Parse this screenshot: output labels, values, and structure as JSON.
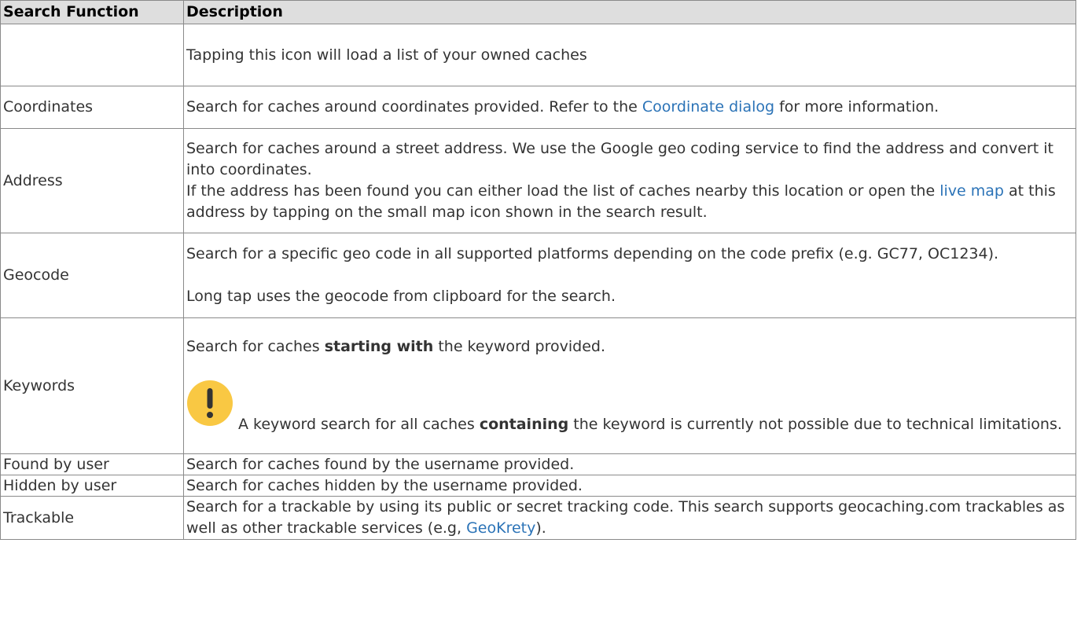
{
  "table": {
    "headers": {
      "function": "Search Function",
      "description": "Description"
    },
    "rows": [
      {
        "function": "",
        "description": "Tapping this icon will load a list of your owned caches"
      },
      {
        "function": "Coordinates",
        "desc_before": "Search for caches around coordinates provided. Refer to the ",
        "desc_link": "Coordinate dialog",
        "desc_after": " for more information."
      },
      {
        "function": "Address",
        "desc_p1": "Search for caches around a street address. We use the Google geo coding service to find the address and convert it into coordinates.",
        "desc_p2_before": "If the address has been found you can either load the list of caches nearby this location or open the ",
        "desc_p2_link": "live map",
        "desc_p2_after": " at this address by tapping on the small map icon shown in the search result."
      },
      {
        "function": "Geocode",
        "desc_p1": "Search for a specific geo code in all supported platforms depending on the code prefix (e.g. GC77, OC1234).",
        "desc_p2": "Long tap uses the geocode from clipboard for the search."
      },
      {
        "function": "Keywords",
        "desc_p1_before": "Search for caches ",
        "desc_p1_bold": "starting with",
        "desc_p1_after": " the keyword provided.",
        "warning_before": " A keyword search for all caches ",
        "warning_bold": "containing",
        "warning_after": " the keyword is currently not possible due to technical limitations.",
        "warning_icon": "exclamation-warning-icon",
        "warning_color": "#f9c843"
      },
      {
        "function": "Found by user",
        "description": "Search for caches found by the username provided."
      },
      {
        "function": "Hidden by user",
        "description": "Search for caches hidden by the username provided."
      },
      {
        "function": "Trackable",
        "desc_before": "Search for a trackable by using its public or secret tracking code. This search supports geocaching.com trackables as well as other trackable services (e.g, ",
        "desc_link": "GeoKrety",
        "desc_after": ")."
      }
    ]
  },
  "colors": {
    "link": "#2b73b7",
    "header_bg": "#dedede",
    "border": "#8a8a8a",
    "text": "#333333"
  }
}
